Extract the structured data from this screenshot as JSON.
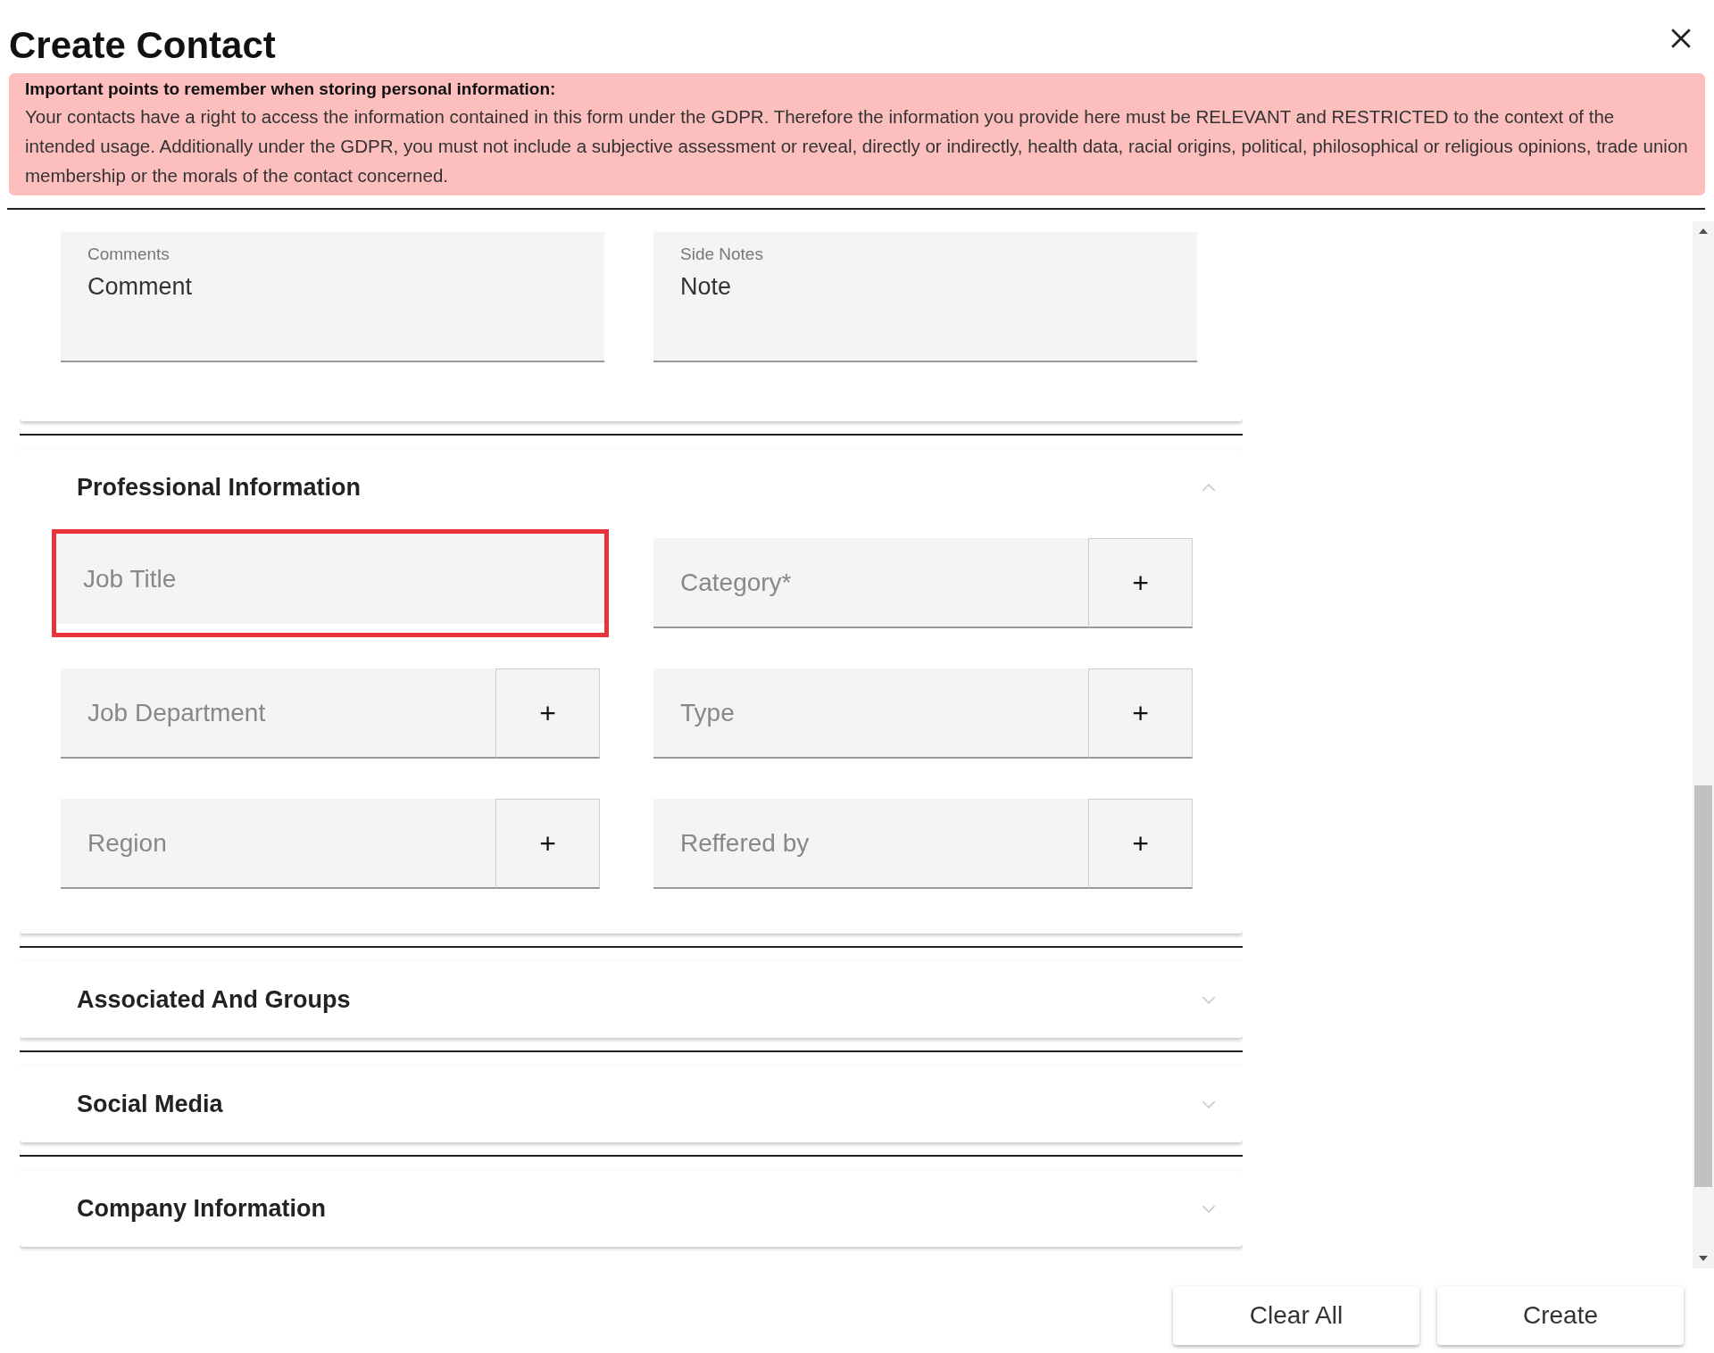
{
  "dialog": {
    "title": "Create Contact"
  },
  "notice": {
    "heading": "Important points to remember when storing personal information:",
    "body": "Your contacts have a right to access the information contained in this form under the GDPR. Therefore the information you provide here must be RELEVANT and RESTRICTED to the context of the intended usage. Additionally under the GDPR, you must not include a subjective assessment or reveal, directly or indirectly, health data, racial origins, political, philosophical or religious opinions, trade union membership or the morals of the contact concerned."
  },
  "notes_card": {
    "fields": [
      {
        "label": "Comments",
        "value": "Comment"
      },
      {
        "label": "Side Notes",
        "value": "Note"
      }
    ]
  },
  "sections": [
    {
      "title": "Professional Information",
      "expanded": true,
      "fields": [
        {
          "kind": "text",
          "placeholder": "Job Title",
          "highlighted": true
        },
        {
          "kind": "add",
          "placeholder": "Category*",
          "highlighted": false,
          "button": "+"
        },
        {
          "kind": "add",
          "placeholder": "Job Department",
          "highlighted": false,
          "button": "+"
        },
        {
          "kind": "add",
          "placeholder": "Type",
          "highlighted": false,
          "button": "+"
        },
        {
          "kind": "add",
          "placeholder": "Region",
          "highlighted": false,
          "button": "+"
        },
        {
          "kind": "add",
          "placeholder": "Reffered by",
          "highlighted": false,
          "button": "+"
        }
      ]
    },
    {
      "title": "Associated And Groups",
      "expanded": false
    },
    {
      "title": "Social Media",
      "expanded": false
    },
    {
      "title": "Company Information",
      "expanded": false
    }
  ],
  "buttons": [
    "Clear All",
    "Create"
  ]
}
